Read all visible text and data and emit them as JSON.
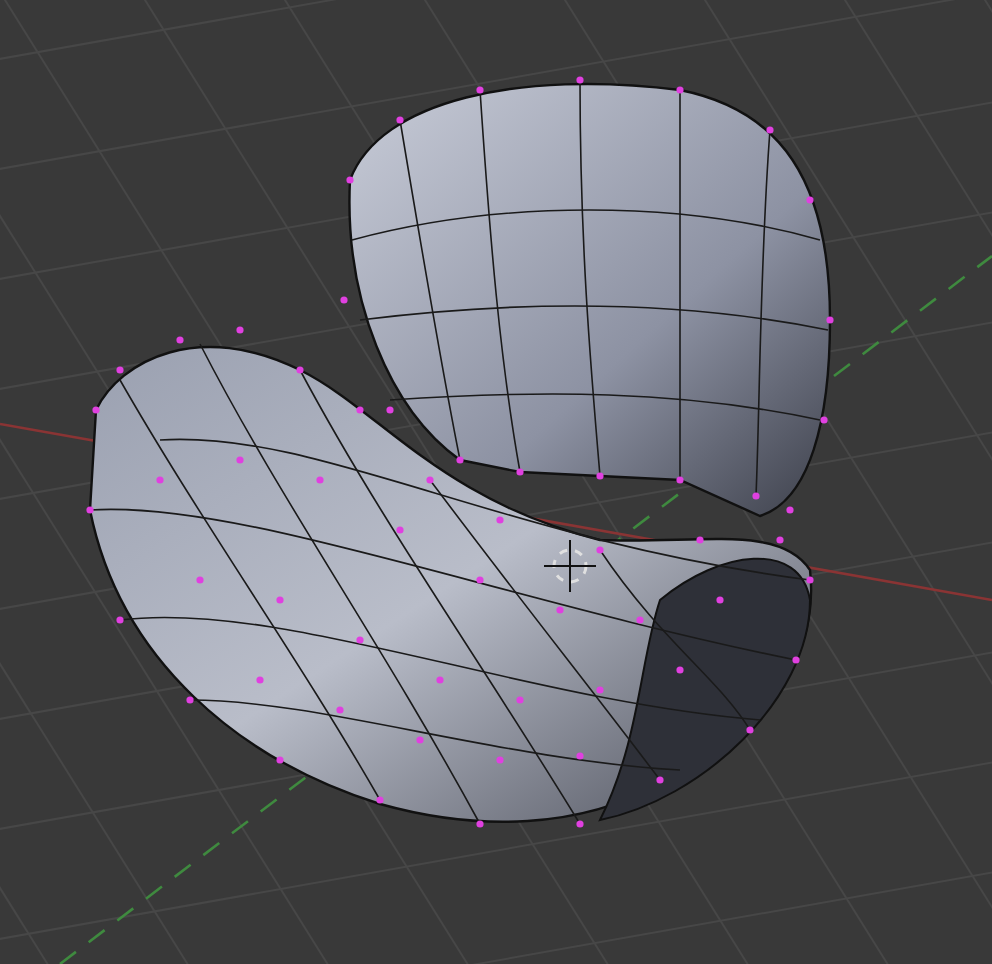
{
  "viewport": {
    "kind": "mesh-edit"
  }
}
